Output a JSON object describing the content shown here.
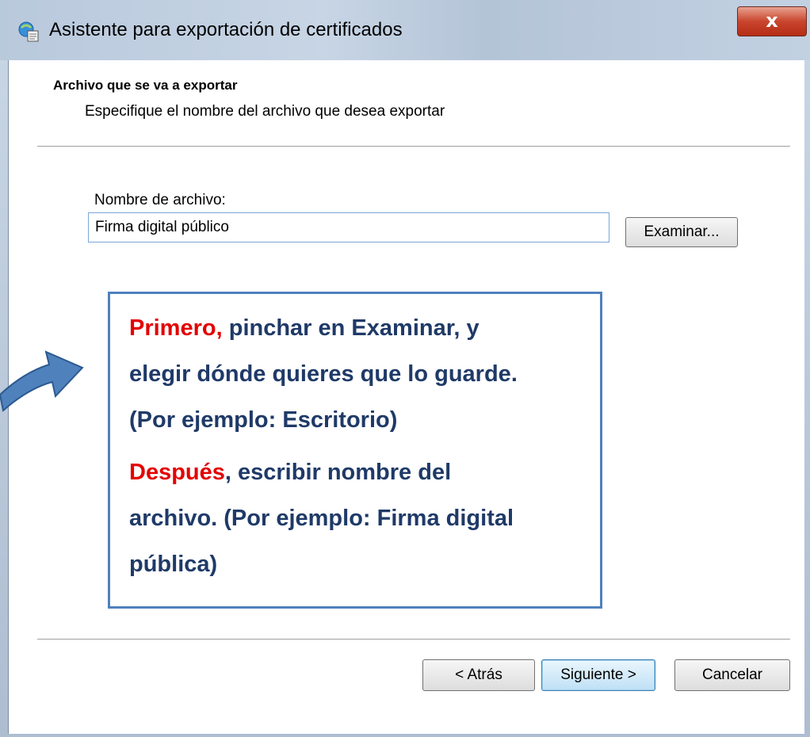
{
  "window": {
    "title": "Asistente para exportación de certificados",
    "close_label": "x"
  },
  "header": {
    "title": "Archivo que se va a exportar",
    "subtitle": "Especifique el nombre del archivo que desea exportar"
  },
  "form": {
    "filename_label": "Nombre de archivo:",
    "filename_value": "Firma digital público",
    "browse_button": "Examinar..."
  },
  "callout": {
    "line1_highlight": "Primero,",
    "line1_rest": " pinchar en Examinar, y",
    "line2": "elegir dónde quieres que lo guarde.",
    "line3": "(Por ejemplo: Escritorio)",
    "line4_highlight": "Después",
    "line4_rest": ", escribir nombre del",
    "line5": "archivo. (Por ejemplo: Firma digital",
    "line6": "pública)"
  },
  "footer": {
    "back_button": "< Atrás",
    "next_button": "Siguiente >",
    "cancel_button": "Cancelar"
  },
  "colors": {
    "callout_border": "#4f81bd",
    "callout_text": "#1f3a68",
    "highlight": "#e30000",
    "arrow": "#4f81bd"
  }
}
